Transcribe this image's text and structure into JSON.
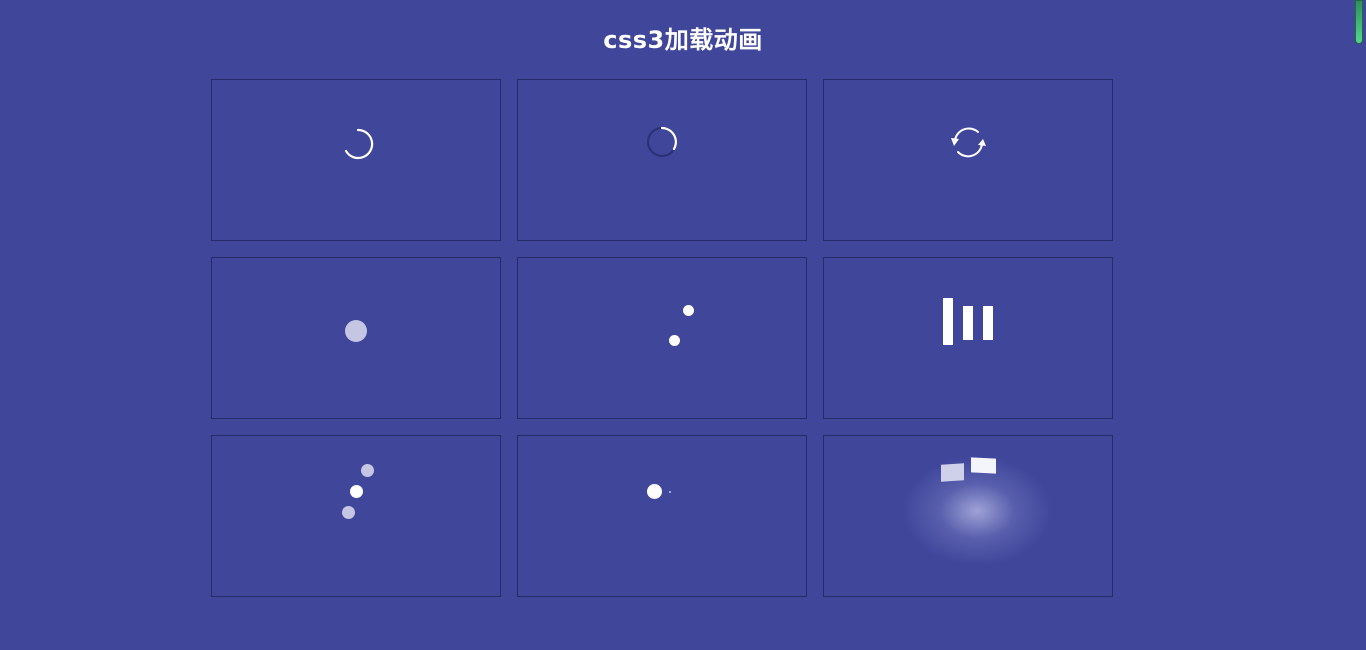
{
  "page": {
    "title": "css3加载动画"
  },
  "colors": {
    "background": "#40479b",
    "cell_border": "#262b6a",
    "foreground": "#ffffff",
    "muted": "#c5c6e4",
    "scrollbar": "#55d68e"
  },
  "loaders": [
    {
      "icon": "ring-spinner-icon"
    },
    {
      "icon": "faded-ring-spinner-icon"
    },
    {
      "icon": "refresh-arrows-icon"
    },
    {
      "icon": "pulse-dot-icon"
    },
    {
      "icon": "orbit-dots-icon"
    },
    {
      "icon": "equalizer-bars-icon"
    },
    {
      "icon": "bouncing-dots-icon"
    },
    {
      "icon": "comet-dot-icon"
    },
    {
      "icon": "flipping-cards-icon"
    }
  ]
}
